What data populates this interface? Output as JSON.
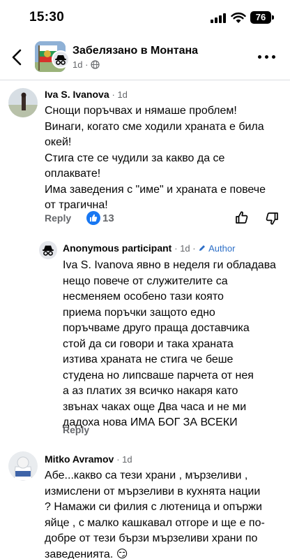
{
  "status_bar": {
    "time": "15:30",
    "battery": "76"
  },
  "header": {
    "group_name": "Забелязано в Монтана",
    "meta_time": "1d",
    "meta_separator": "·"
  },
  "comments": [
    {
      "author": "Iva S. Ivanova",
      "time": "1d",
      "lines": [
        "Снощи поръчвах и нямаше проблем!",
        "Винаги, когато сме ходили храната е била",
        "окей!",
        "Стига сте се чудили за какво да се",
        "оплаквате!",
        "Има заведения с \"име\" и храната е повече",
        "от трагична!"
      ],
      "reply_label": "Reply",
      "reaction_count": "13"
    },
    {
      "author": "Anonymous participant",
      "time": "1d",
      "badge": "Author",
      "lines": [
        "Iva S. Ivanova явно в неделя ги обладава",
        "нещо повече от служителите са",
        "несменяем особено тази която",
        "приема поръчки защото едно",
        "поръчваме друго праща доставчика",
        "стой да си говори и така храната",
        "изтива храната не стига че беше",
        "студена но липсваше парчета от нея",
        "а аз платих зя всичко накаря като",
        "звънах чаках още Два часа и не ми",
        "дадоха нова ИМА БОГ ЗА ВСЕКИ"
      ],
      "reply_label": "Reply"
    },
    {
      "author": "Mitko Avramov",
      "time": "1d",
      "lines": [
        "Абе...какво са тези храни , мързеливи ,",
        "измислени от мързеливи в кухнята  нации",
        "? Намажи си филия с лютеница и опържи",
        "яйце , с малко кашкавал отгоре и ще е по-",
        "добре от тези бързи мързеливи храни по",
        "заведенията. 😏"
      ]
    }
  ],
  "colors": {
    "link_blue": "#1877f2",
    "secondary_text": "#65676b",
    "divider": "#dadde1"
  },
  "icons": [
    "chevron-left-icon",
    "more-icon",
    "globe-icon",
    "like-icon",
    "thumbs-up-outline-icon",
    "thumbs-down-outline-icon",
    "pencil-icon",
    "incognito-icon"
  ]
}
